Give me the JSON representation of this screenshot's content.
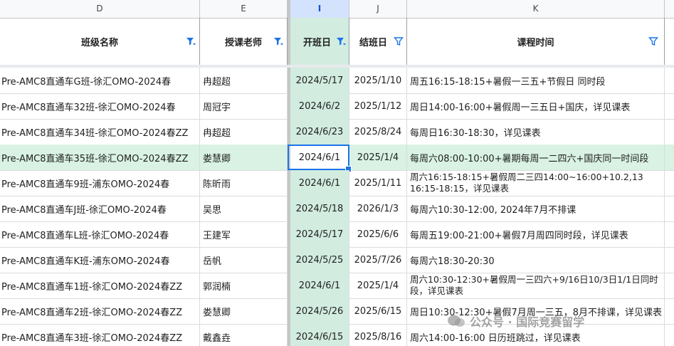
{
  "column_letters": [
    "D",
    "E",
    "I",
    "J",
    "K"
  ],
  "headers": {
    "class_name": "班级名称",
    "teacher": "授课老师",
    "start_date": "开班日",
    "end_date": "结班日",
    "schedule": "课程时间"
  },
  "rows": [
    {
      "class_name": "Pre-AMC8直通车G班-徐汇OMO-2024春",
      "teacher": "冉超超",
      "start": "2024/5/17",
      "end": "2025/1/10",
      "schedule": "周五16:15-18:15+暑假一三五+节假日 同时段"
    },
    {
      "class_name": "Pre-AMC8直通车32班-徐汇OMO-2024春",
      "teacher": "周冠宇",
      "start": "2024/6/2",
      "end": "2025/1/12",
      "schedule": "周日14:00-16:00+暑假周一三五日+国庆，详见课表"
    },
    {
      "class_name": "Pre-AMC8直通车34班-徐汇OMO-2024春ZZ",
      "teacher": "冉超超",
      "start": "2024/6/23",
      "end": "2025/8/24",
      "schedule": "每周日16:30-18:30，详见课表"
    },
    {
      "class_name": "Pre-AMC8直通车35班-徐汇OMO-2024春ZZ",
      "teacher": "娄慧卿",
      "start": "2024/6/1",
      "end": "2025/1/4",
      "schedule": "每周六08:00-10:00+暑期每周一二四六+国庆同一时间段"
    },
    {
      "class_name": "Pre-AMC8直通车9班-浦东OMO-2024春",
      "teacher": "陈昕雨",
      "start": "2024/6/1",
      "end": "2025/1/11",
      "schedule": "周六16:15-18:15+暑假周二三四14:00~16:00+10.2,13 16:15-18:15，详见课表"
    },
    {
      "class_name": "Pre-AMC8直通车J班-徐汇OMO-2024春",
      "teacher": "吴思",
      "start": "2024/5/18",
      "end": "2026/1/3",
      "schedule": "每周六10:30-12:00, 2024年7月不排课"
    },
    {
      "class_name": "Pre-AMC8直通车L班-徐汇OMO-2024春",
      "teacher": "王建军",
      "start": "2024/5/17",
      "end": "2025/6/6",
      "schedule": "每周五19:00-21:00+暑假7月周四同时段，详见课表"
    },
    {
      "class_name": "Pre-AMC8直通车K班-浦东OMO-2024春",
      "teacher": "岳帆",
      "start": "2024/5/25",
      "end": "2025/7/26",
      "schedule": "每周六18:30-20:30"
    },
    {
      "class_name": "Pre-AMC8直通车1班-徐汇OMO-2024春ZZ",
      "teacher": "郭润楠",
      "start": "2024/6/1",
      "end": "2025/1/4",
      "schedule": "周六10:30-12:30+暑假周一三四六+9/16日10/3日1/1日同时段，详见课表"
    },
    {
      "class_name": "Pre-AMC8直通车2班-徐汇OMO-2024春ZZ",
      "teacher": "娄慧卿",
      "start": "2024/5/26",
      "end": "2025/6/15",
      "schedule": "周日10:30-12:30+暑假7月周一三五，8月不排课，详见课表"
    },
    {
      "class_name": "Pre-AMC8直通车3班-徐汇OMO-2024春ZZ",
      "teacher": "戴鑫垚",
      "start": "2024/6/15",
      "end": "2025/8/16",
      "schedule": "周六14:00-16:00 日历班跳过，详见课表"
    }
  ],
  "watermark": "公众号 · 国际竞赛留学",
  "colors": {
    "accent": "#1a73e8",
    "selected_column": "#d2ece0",
    "highlight_row": "#d9f2e3"
  }
}
